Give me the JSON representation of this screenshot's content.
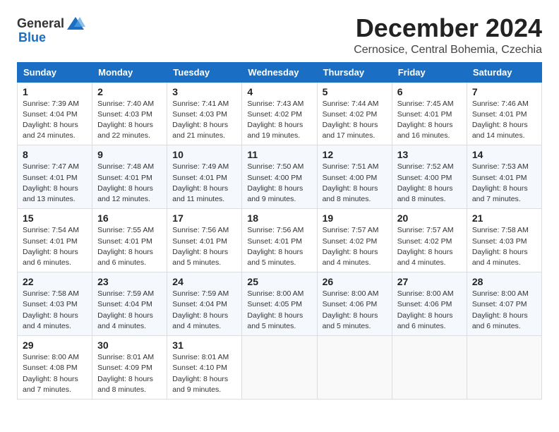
{
  "logo": {
    "general": "General",
    "blue": "Blue"
  },
  "header": {
    "month_year": "December 2024",
    "location": "Cernosice, Central Bohemia, Czechia"
  },
  "days_of_week": [
    "Sunday",
    "Monday",
    "Tuesday",
    "Wednesday",
    "Thursday",
    "Friday",
    "Saturday"
  ],
  "weeks": [
    [
      {
        "day": "1",
        "info": "Sunrise: 7:39 AM\nSunset: 4:04 PM\nDaylight: 8 hours\nand 24 minutes."
      },
      {
        "day": "2",
        "info": "Sunrise: 7:40 AM\nSunset: 4:03 PM\nDaylight: 8 hours\nand 22 minutes."
      },
      {
        "day": "3",
        "info": "Sunrise: 7:41 AM\nSunset: 4:03 PM\nDaylight: 8 hours\nand 21 minutes."
      },
      {
        "day": "4",
        "info": "Sunrise: 7:43 AM\nSunset: 4:02 PM\nDaylight: 8 hours\nand 19 minutes."
      },
      {
        "day": "5",
        "info": "Sunrise: 7:44 AM\nSunset: 4:02 PM\nDaylight: 8 hours\nand 17 minutes."
      },
      {
        "day": "6",
        "info": "Sunrise: 7:45 AM\nSunset: 4:01 PM\nDaylight: 8 hours\nand 16 minutes."
      },
      {
        "day": "7",
        "info": "Sunrise: 7:46 AM\nSunset: 4:01 PM\nDaylight: 8 hours\nand 14 minutes."
      }
    ],
    [
      {
        "day": "8",
        "info": "Sunrise: 7:47 AM\nSunset: 4:01 PM\nDaylight: 8 hours\nand 13 minutes."
      },
      {
        "day": "9",
        "info": "Sunrise: 7:48 AM\nSunset: 4:01 PM\nDaylight: 8 hours\nand 12 minutes."
      },
      {
        "day": "10",
        "info": "Sunrise: 7:49 AM\nSunset: 4:01 PM\nDaylight: 8 hours\nand 11 minutes."
      },
      {
        "day": "11",
        "info": "Sunrise: 7:50 AM\nSunset: 4:00 PM\nDaylight: 8 hours\nand 9 minutes."
      },
      {
        "day": "12",
        "info": "Sunrise: 7:51 AM\nSunset: 4:00 PM\nDaylight: 8 hours\nand 8 minutes."
      },
      {
        "day": "13",
        "info": "Sunrise: 7:52 AM\nSunset: 4:00 PM\nDaylight: 8 hours\nand 8 minutes."
      },
      {
        "day": "14",
        "info": "Sunrise: 7:53 AM\nSunset: 4:01 PM\nDaylight: 8 hours\nand 7 minutes."
      }
    ],
    [
      {
        "day": "15",
        "info": "Sunrise: 7:54 AM\nSunset: 4:01 PM\nDaylight: 8 hours\nand 6 minutes."
      },
      {
        "day": "16",
        "info": "Sunrise: 7:55 AM\nSunset: 4:01 PM\nDaylight: 8 hours\nand 6 minutes."
      },
      {
        "day": "17",
        "info": "Sunrise: 7:56 AM\nSunset: 4:01 PM\nDaylight: 8 hours\nand 5 minutes."
      },
      {
        "day": "18",
        "info": "Sunrise: 7:56 AM\nSunset: 4:01 PM\nDaylight: 8 hours\nand 5 minutes."
      },
      {
        "day": "19",
        "info": "Sunrise: 7:57 AM\nSunset: 4:02 PM\nDaylight: 8 hours\nand 4 minutes."
      },
      {
        "day": "20",
        "info": "Sunrise: 7:57 AM\nSunset: 4:02 PM\nDaylight: 8 hours\nand 4 minutes."
      },
      {
        "day": "21",
        "info": "Sunrise: 7:58 AM\nSunset: 4:03 PM\nDaylight: 8 hours\nand 4 minutes."
      }
    ],
    [
      {
        "day": "22",
        "info": "Sunrise: 7:58 AM\nSunset: 4:03 PM\nDaylight: 8 hours\nand 4 minutes."
      },
      {
        "day": "23",
        "info": "Sunrise: 7:59 AM\nSunset: 4:04 PM\nDaylight: 8 hours\nand 4 minutes."
      },
      {
        "day": "24",
        "info": "Sunrise: 7:59 AM\nSunset: 4:04 PM\nDaylight: 8 hours\nand 4 minutes."
      },
      {
        "day": "25",
        "info": "Sunrise: 8:00 AM\nSunset: 4:05 PM\nDaylight: 8 hours\nand 5 minutes."
      },
      {
        "day": "26",
        "info": "Sunrise: 8:00 AM\nSunset: 4:06 PM\nDaylight: 8 hours\nand 5 minutes."
      },
      {
        "day": "27",
        "info": "Sunrise: 8:00 AM\nSunset: 4:06 PM\nDaylight: 8 hours\nand 6 minutes."
      },
      {
        "day": "28",
        "info": "Sunrise: 8:00 AM\nSunset: 4:07 PM\nDaylight: 8 hours\nand 6 minutes."
      }
    ],
    [
      {
        "day": "29",
        "info": "Sunrise: 8:00 AM\nSunset: 4:08 PM\nDaylight: 8 hours\nand 7 minutes."
      },
      {
        "day": "30",
        "info": "Sunrise: 8:01 AM\nSunset: 4:09 PM\nDaylight: 8 hours\nand 8 minutes."
      },
      {
        "day": "31",
        "info": "Sunrise: 8:01 AM\nSunset: 4:10 PM\nDaylight: 8 hours\nand 9 minutes."
      },
      null,
      null,
      null,
      null
    ]
  ]
}
